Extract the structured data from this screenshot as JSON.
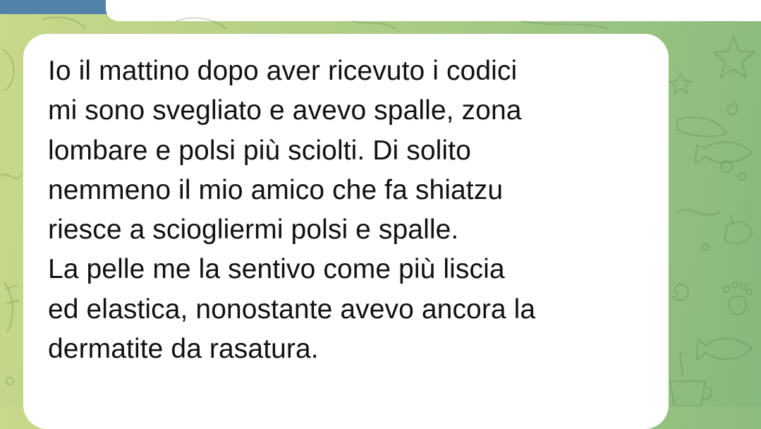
{
  "chat": {
    "message": {
      "text": "Io il mattino dopo aver ricevuto i codici\nmi sono svegliato e avevo spalle, zona\nlombare e polsi più sciolti. Di solito\nnemmeno il mio amico che fa shiatzu\nriesce a sciogliermi polsi e spalle.\nLa pelle me la sentivo come più liscia\ned elastica, nonostante avevo ancora la\ndermatite da rasatura."
    }
  },
  "colors": {
    "header": "#5382a9",
    "bubble": "#ffffff",
    "text": "#111111",
    "wallpaper_left": "#c9d98a",
    "wallpaper_right": "#86b97c"
  },
  "icons": [
    "star-doodle",
    "shell-doodle",
    "paw-doodle",
    "fish-doodle",
    "bird-doodle",
    "cup-doodle",
    "spiral-doodle"
  ]
}
